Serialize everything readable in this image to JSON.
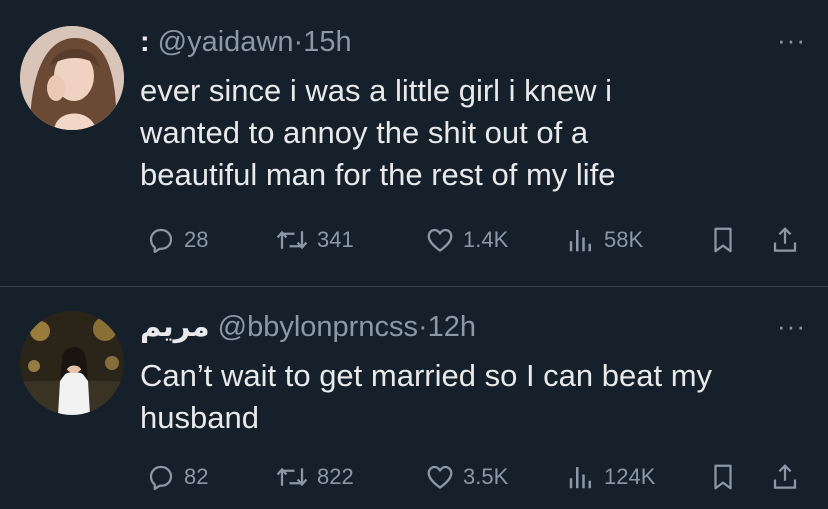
{
  "tweets": [
    {
      "display_name": ":",
      "handle": "@yaidawn",
      "separator": "·",
      "time": "15h",
      "more_label": "···",
      "text": "ever since i was a little girl i knew i\nwanted to annoy the shit out of a\nbeautiful man for the rest of my life",
      "replies": "28",
      "reposts": "341",
      "likes": "1.4K",
      "views": "58K"
    },
    {
      "display_name": "مريم",
      "handle": "@bbylonprncss",
      "separator": "·",
      "time": "12h",
      "more_label": "···",
      "text": "Can’t wait to get married so I can beat my\nhusband",
      "replies": "82",
      "reposts": "822",
      "likes": "3.5K",
      "views": "124K"
    }
  ],
  "icons": {
    "reply": "reply-bubble-icon",
    "repost": "repost-arrows-icon",
    "like": "heart-icon",
    "views": "views-bar-chart-icon",
    "bookmark": "bookmark-icon",
    "share": "share-upload-icon"
  },
  "colors": {
    "background": "#15202b",
    "text": "#e7e9ea",
    "secondary_text": "#8b98a5",
    "divider": "#38444d"
  }
}
